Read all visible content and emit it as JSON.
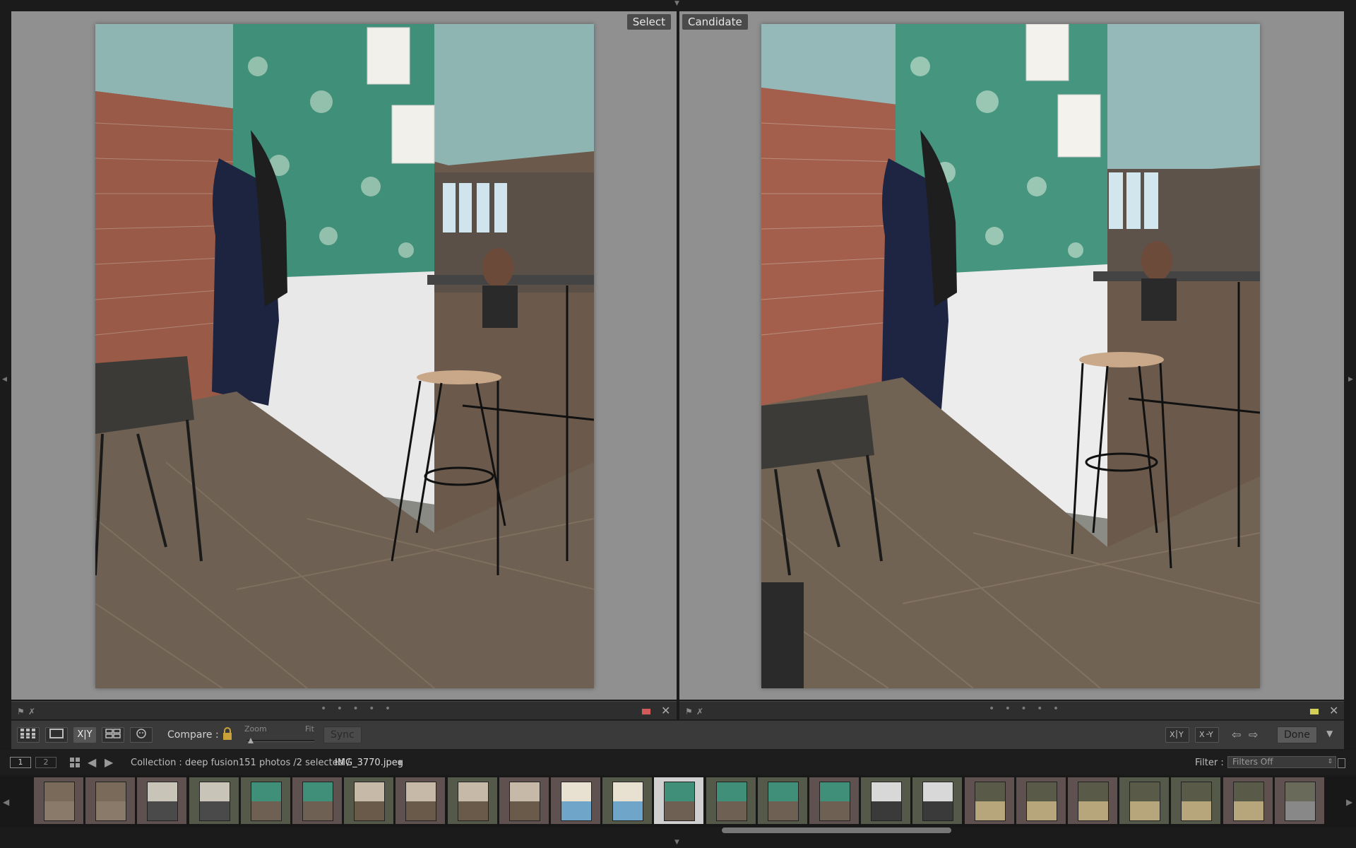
{
  "compare": {
    "select_label": "Select",
    "candidate_label": "Candidate",
    "left_color_label": "#d45a5a",
    "right_color_label": "#d4cf55"
  },
  "pane_footer": {
    "flag_icons": [
      "flag-icon",
      "reject-flag-icon"
    ],
    "rating_dots": "• • • • •",
    "close_glyph": "✕"
  },
  "toolbar": {
    "view_modes": [
      "grid-view-icon",
      "loupe-view-icon",
      "compare-view-icon",
      "survey-view-icon",
      "people-view-icon"
    ],
    "compare_mode_label": "X|Y",
    "compare_label": "Compare :",
    "zoom_label": "Zoom",
    "fit_label": "Fit",
    "sync_label": "Sync",
    "done_label": "Done"
  },
  "filmstrip_header": {
    "page1": "1",
    "page2": "2",
    "collection": "Collection : deep fusion",
    "selection_info": "151 photos /2 selected /",
    "filename": "IMG_3770.jpeg",
    "filter_label": "Filter :",
    "filter_value": "Filters Off"
  },
  "filmstrip": {
    "thumbnails": [
      {
        "scene": "texture",
        "label": "red"
      },
      {
        "scene": "texture",
        "label": "red"
      },
      {
        "scene": "room",
        "label": "red"
      },
      {
        "scene": "room",
        "label": "green"
      },
      {
        "scene": "cafe",
        "label": "green"
      },
      {
        "scene": "cafe",
        "label": "red"
      },
      {
        "scene": "table",
        "label": "green"
      },
      {
        "scene": "table",
        "label": "red"
      },
      {
        "scene": "table",
        "label": "green"
      },
      {
        "scene": "table",
        "label": "red"
      },
      {
        "scene": "plate",
        "label": "red"
      },
      {
        "scene": "plate",
        "label": "green"
      },
      {
        "scene": "cafe",
        "label": "selected"
      },
      {
        "scene": "cafe",
        "label": "green"
      },
      {
        "scene": "cafe",
        "label": "green"
      },
      {
        "scene": "cafe",
        "label": "red"
      },
      {
        "scene": "street",
        "label": "green"
      },
      {
        "scene": "street",
        "label": "green"
      },
      {
        "scene": "forest",
        "label": "red"
      },
      {
        "scene": "forest",
        "label": "red"
      },
      {
        "scene": "forest",
        "label": "red"
      },
      {
        "scene": "forest",
        "label": "green"
      },
      {
        "scene": "forest",
        "label": "green"
      },
      {
        "scene": "forest",
        "label": "red"
      },
      {
        "scene": "bench",
        "label": "red"
      }
    ]
  }
}
